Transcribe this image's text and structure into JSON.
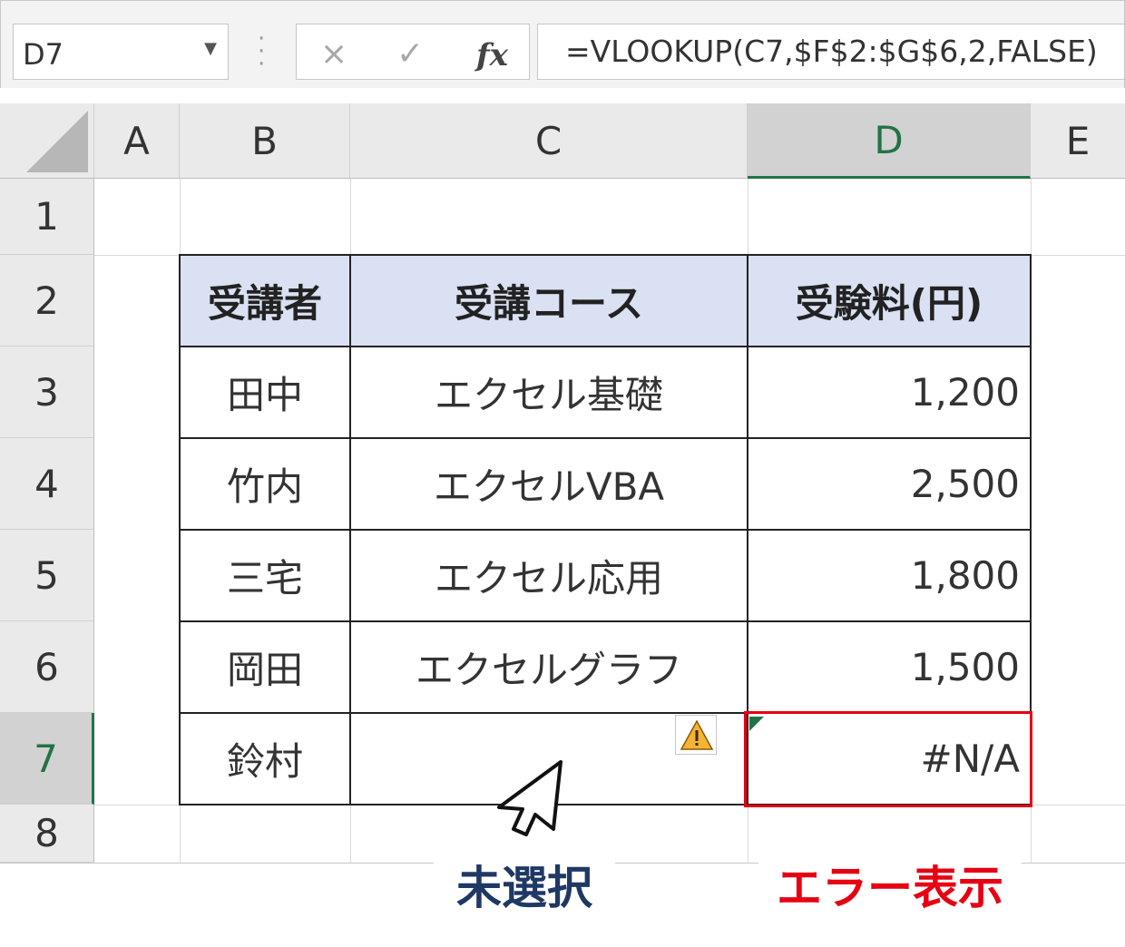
{
  "formula_bar": {
    "name_box": "D7",
    "cancel_icon": "×",
    "enter_icon": "✓",
    "fx_label": "fx",
    "formula": "=VLOOKUP(C7,$F$2:$G$6,2,FALSE)"
  },
  "columns": [
    "A",
    "B",
    "C",
    "D",
    "E"
  ],
  "rows": [
    "1",
    "2",
    "3",
    "4",
    "5",
    "6",
    "7",
    "8"
  ],
  "table": {
    "headers": [
      "受講者",
      "受講コース",
      "受験料(円)"
    ],
    "body": [
      [
        "田中",
        "エクセル基礎",
        "1,200"
      ],
      [
        "竹内",
        "エクセルVBA",
        "2,500"
      ],
      [
        "三宅",
        "エクセル応用",
        "1,800"
      ],
      [
        "岡田",
        "エクセルグラフ",
        "1,500"
      ],
      [
        "鈴村",
        "",
        "#N/A"
      ]
    ]
  },
  "annotations": {
    "unselected": "未選択",
    "error_display": "エラー表示"
  },
  "colors": {
    "header_fill": "#d9e1f2",
    "selection_green": "#217346",
    "error_red": "#e60012",
    "label_navy": "#1f3864"
  }
}
